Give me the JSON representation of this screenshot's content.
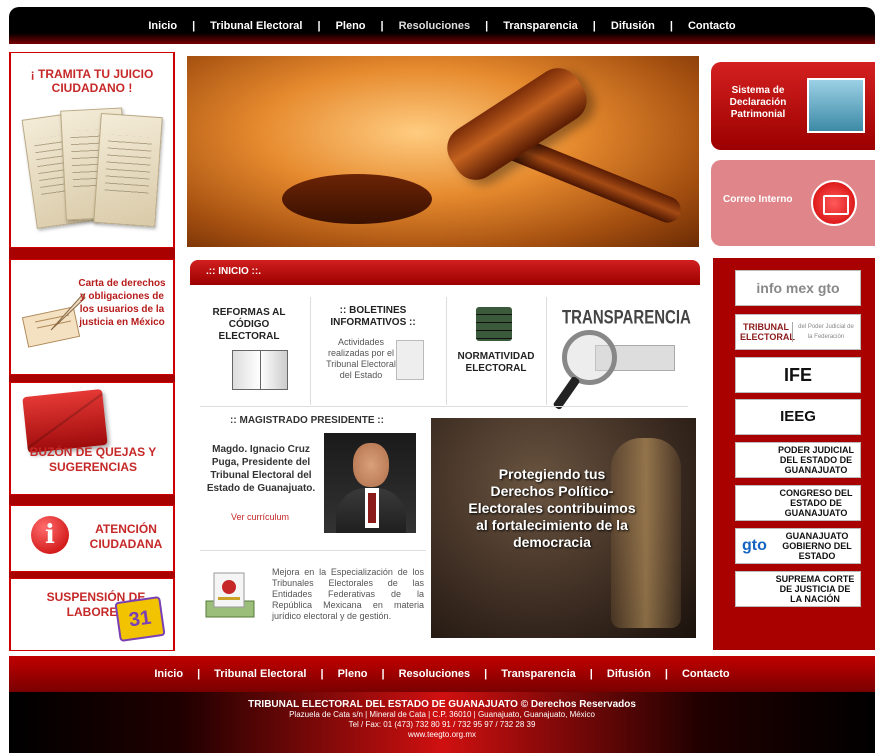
{
  "top_nav": {
    "items": [
      "Inicio",
      "Tribunal Electoral",
      "Pleno",
      "Resoluciones",
      "Transparencia",
      "Difusión",
      "Contacto"
    ],
    "separator": "|"
  },
  "left": {
    "tramita": "¡ TRAMITA TU JUICIO CIUDADANO !",
    "carta": "Carta de derechos y obligaciones de los usuarios de la justicia en México",
    "buzon": "BUZÓN DE QUEJAS Y SUGERENCIAS",
    "atencion": "ATENCIÓN CIUDADANA",
    "suspension": "SUSPENSIÓN DE LABORES"
  },
  "center": {
    "inicio_bar": ".:: INICIO ::.",
    "reformas": "REFORMAS AL CÓDIGO ELECTORAL",
    "boletines_title": ":: BOLETINES INFORMATIVOS ::",
    "boletines_text": "Actividades realizadas por el Tribunal Electoral del Estado",
    "normatividad": "NORMATIVIDAD ELECTORAL",
    "transparencia": "TRANSPARENCIA",
    "magistrado_title": ":: MAGISTRADO PRESIDENTE ::",
    "magistrado_name": "Magdo. Ignacio Cruz Puga, Presidente del Tribunal Electoral del Estado de Guanajuato.",
    "ver_curriculum": "Ver currículum",
    "mejora_text": "Mejora en la Especialización de los Tribunales Electorales de las Entidades Federativas de la República Mexicana en materia jurídico electoral y de gestión.",
    "banner_text": "Protegiendo tus Derechos Político-Electorales contribuimos al fortalecimiento de la democracia"
  },
  "right": {
    "sistema": "Sistema de Declaración Patrimonial",
    "correo": "Correo Interno",
    "links": {
      "infomex": "info mex gto",
      "tribunal": "TRIBUNAL ELECTORAL",
      "tribunal_sub": "del Poder Judicial de la Federación",
      "ife": "IFE",
      "ieeg": "IEEG",
      "poder_judicial": "PODER JUDICIAL DEL ESTADO DE GUANAJUATO",
      "congreso": "CONGRESO DEL ESTADO DE GUANAJUATO",
      "gto": "gto",
      "gobierno": "GUANAJUATO GOBIERNO DEL ESTADO",
      "suprema": "SUPREMA CORTE DE JUSTICIA DE LA NACIÓN"
    }
  },
  "bottom_nav": {
    "items": [
      "Inicio",
      "Tribunal Electoral",
      "Pleno",
      "Resoluciones",
      "Transparencia",
      "Difusión",
      "Contacto"
    ]
  },
  "footer": {
    "line1": "TRIBUNAL ELECTORAL DEL ESTADO DE GUANAJUATO   ©   Derechos Reservados",
    "line2": "Plazuela de Cata s/n   |   Mineral de Cata   |   C.P. 36010   |   Guanajuato, Guanajuato, México",
    "line3": "Tel / Fax: 01 (473) 732 80 91   /   732 95 97   /   732 28 39",
    "line4": "www.teegto.org.mx"
  },
  "colors": {
    "accent": "#a90000",
    "nav_bg": "#000000",
    "link_red": "#c62828"
  }
}
